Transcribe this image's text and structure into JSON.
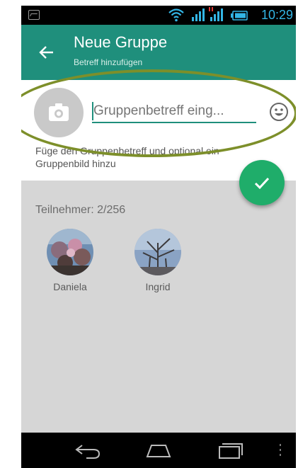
{
  "status_bar": {
    "time": "10:29",
    "icons": [
      "image-notification-icon",
      "wifi-icon",
      "signal-icon",
      "signal-no-data-icon",
      "battery-icon"
    ],
    "accent_color": "#33b5e5"
  },
  "app_bar": {
    "title": "Neue Gruppe",
    "subtitle": "Betreff hinzufügen",
    "color": "#1f8f7c"
  },
  "group_form": {
    "subject_placeholder": "Gruppenbetreff eing...",
    "subject_value": "",
    "hint": "Füge den Gruppenbetreff und optional ein Gruppenbild hinzu"
  },
  "participants": {
    "count_label": "Teilnehmer: 2/256",
    "members": [
      {
        "name": "Daniela"
      },
      {
        "name": "Ingrid"
      }
    ]
  },
  "fab": {
    "icon": "checkmark-icon",
    "color": "#1fad6a"
  },
  "nav_bar": {
    "icons": [
      "back-nav-icon",
      "home-nav-icon",
      "recent-apps-icon",
      "overflow-menu-icon"
    ]
  }
}
